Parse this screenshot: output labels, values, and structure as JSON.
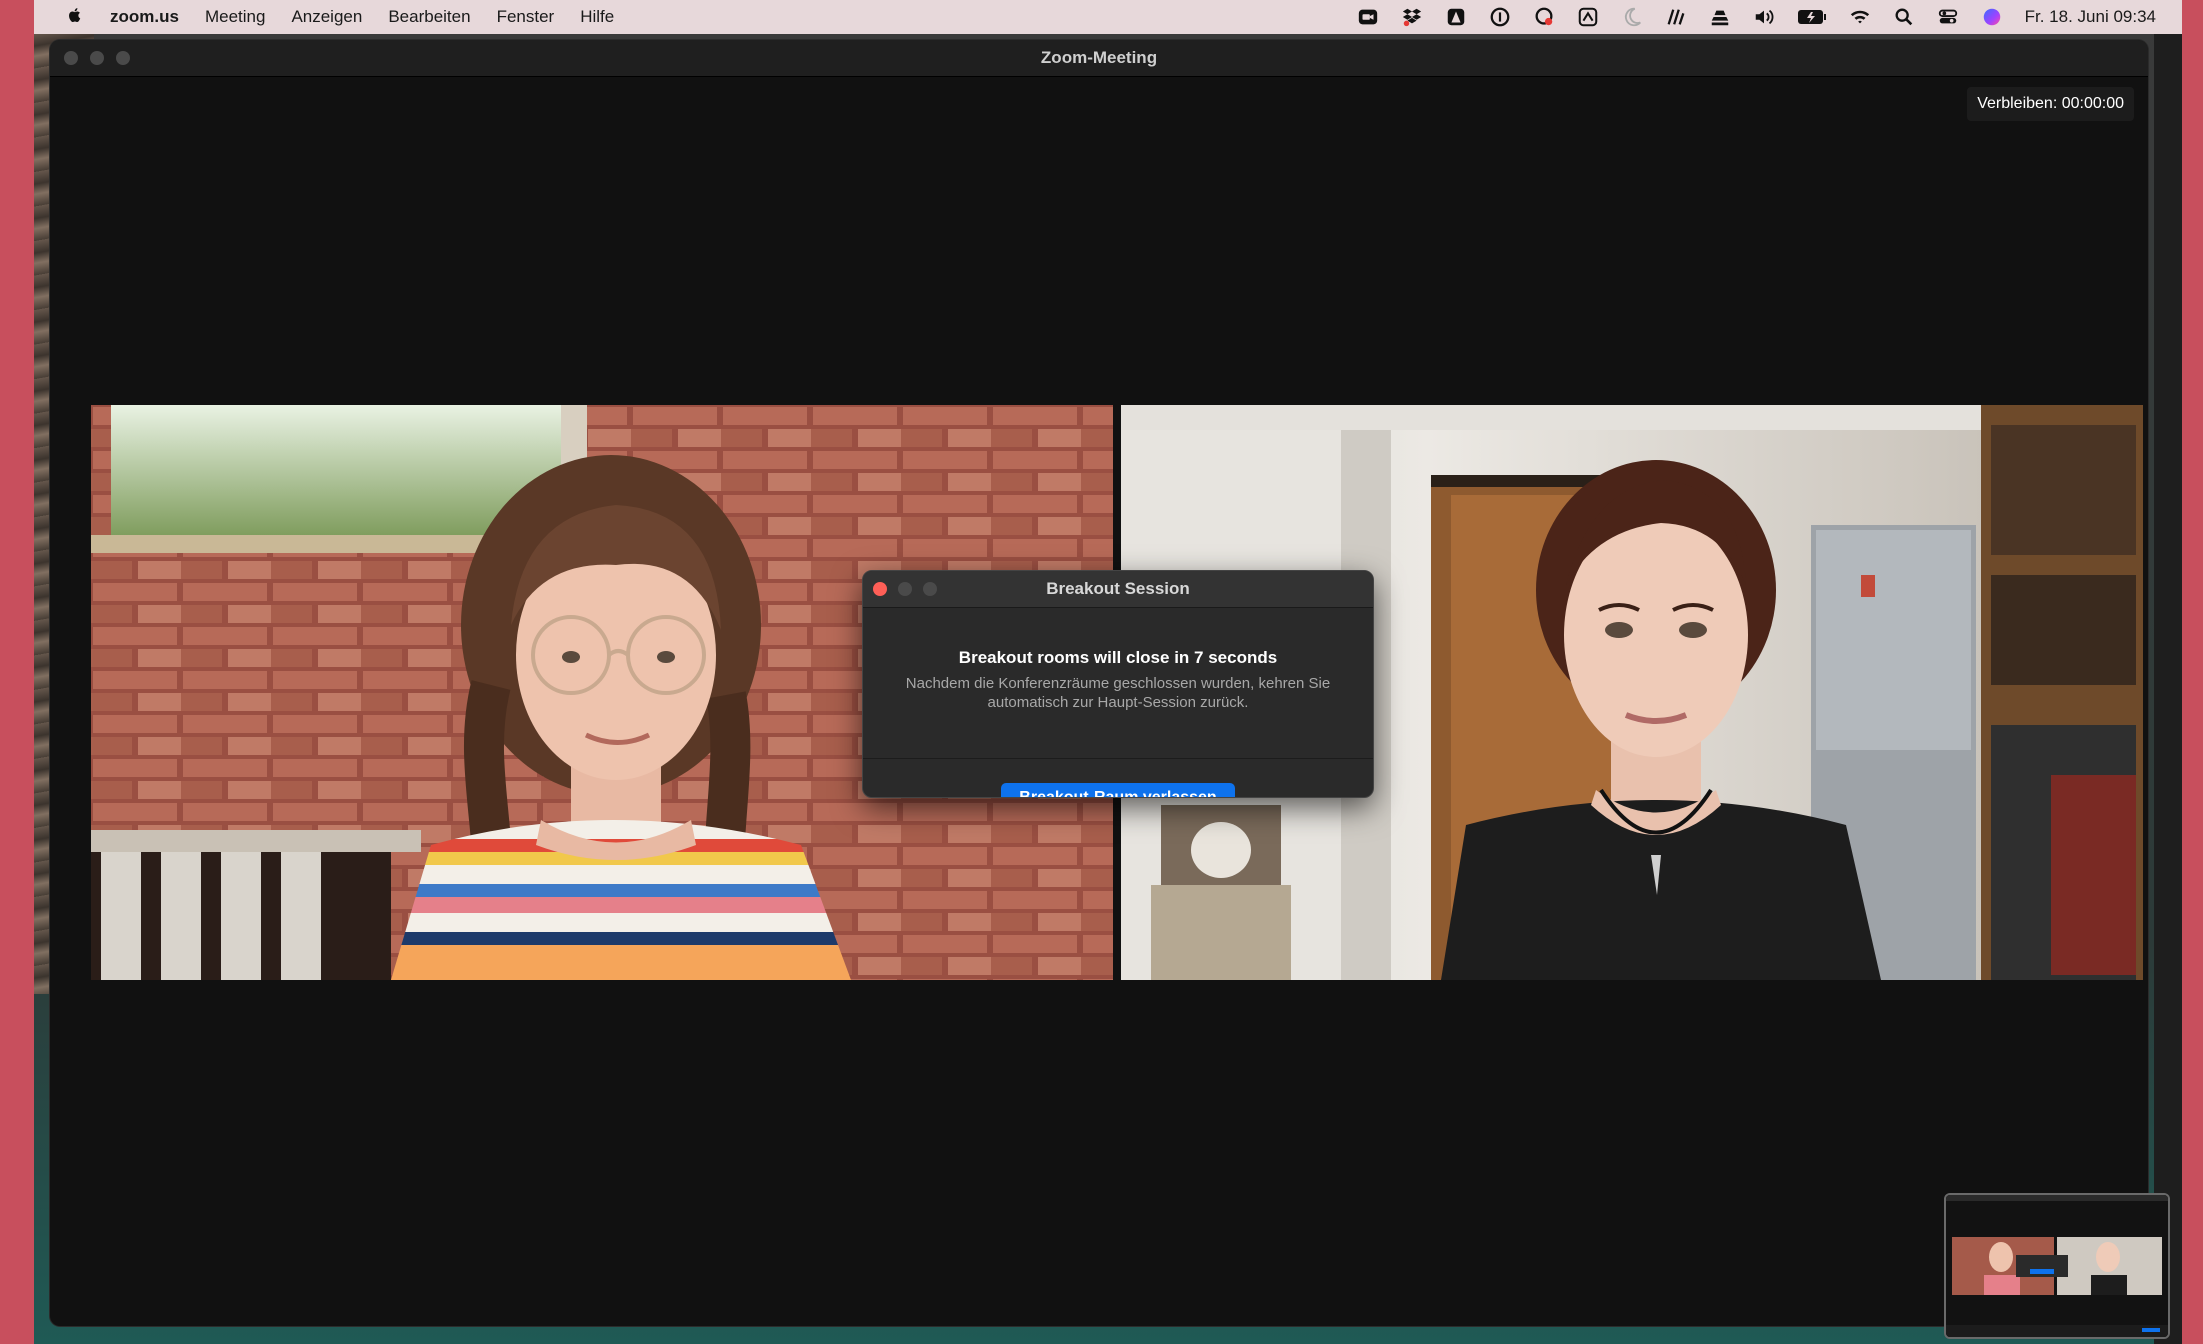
{
  "menubar": {
    "app_name": "zoom.us",
    "menus": [
      "Meeting",
      "Anzeigen",
      "Bearbeiten",
      "Fenster",
      "Hilfe"
    ],
    "status_icons": [
      "zoom-video-icon",
      "dropbox-icon",
      "app-icon",
      "onepassword-icon",
      "cloud-icon",
      "vpn-icon",
      "moon-icon",
      "signal-icon",
      "stack-icon",
      "volume-icon",
      "battery-icon",
      "wifi-icon",
      "search-icon",
      "control-center-icon",
      "siri-icon"
    ],
    "clock": "Fr. 18. Juni 09:34"
  },
  "window": {
    "title": "Zoom-Meeting",
    "remaining": "Verbleiben: 00:00:00"
  },
  "dialog": {
    "title": "Breakout Session",
    "headline": "Breakout rooms will close in 7 seconds",
    "message": "Nachdem die Konferenzräume geschlossen wurden, kehren Sie automatisch zur Haupt-Session zurück.",
    "button": "Breakout-Raum verlassen",
    "accent": "#0e72ed"
  },
  "colors": {
    "background": "#c84f5d",
    "window": "#111111",
    "menubar": "#e7d8da"
  }
}
